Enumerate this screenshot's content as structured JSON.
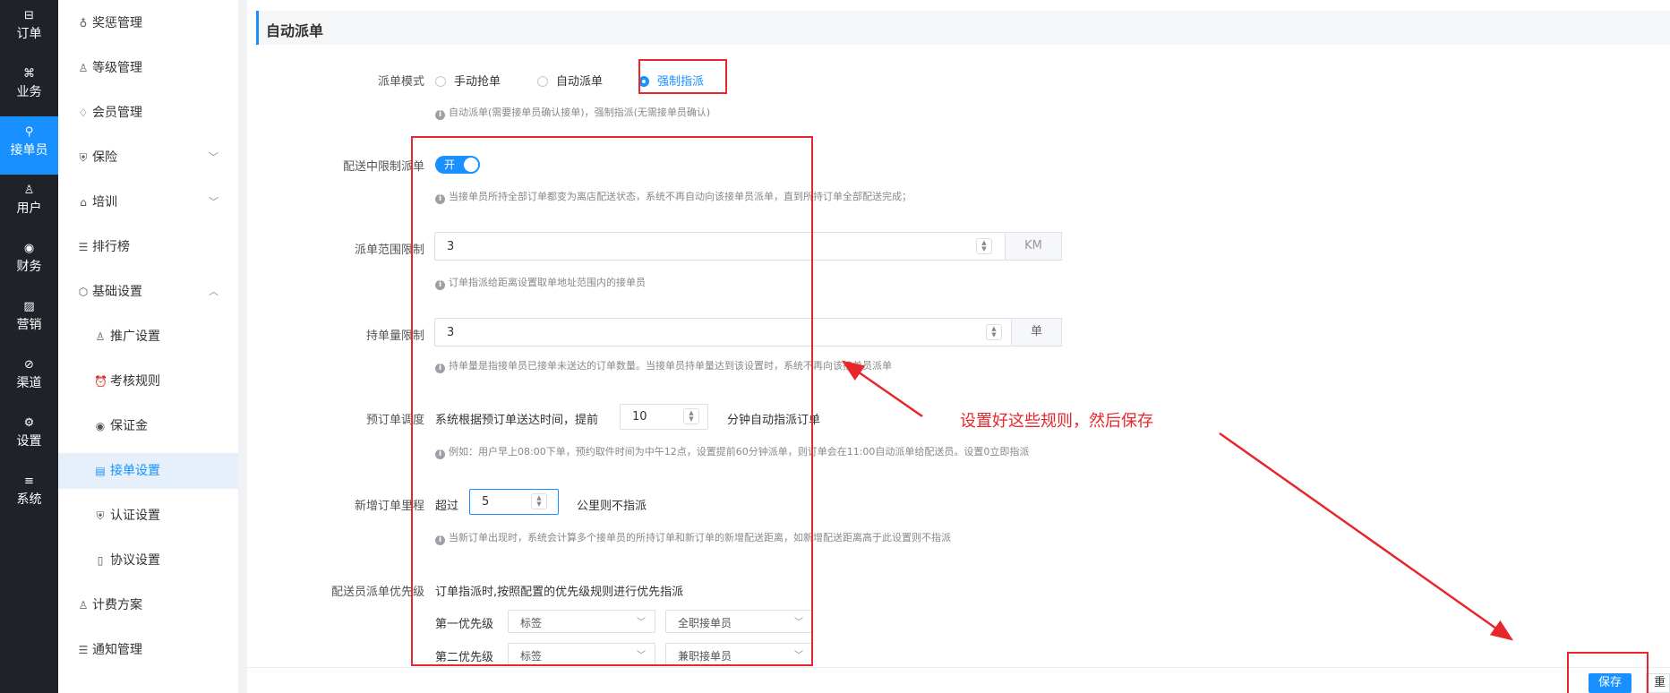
{
  "rail": [
    {
      "icon": "order-icon",
      "glyph": "⊟",
      "label": "订单"
    },
    {
      "icon": "business-icon",
      "glyph": "⌘",
      "label": "业务"
    },
    {
      "icon": "rider-icon",
      "glyph": "⚲",
      "label": "接单员",
      "active": true
    },
    {
      "icon": "user-icon",
      "glyph": "♙",
      "label": "用户"
    },
    {
      "icon": "finance-icon",
      "glyph": "◉",
      "label": "财务"
    },
    {
      "icon": "marketing-icon",
      "glyph": "▨",
      "label": "营销"
    },
    {
      "icon": "channel-icon",
      "glyph": "⊘",
      "label": "渠道"
    },
    {
      "icon": "settings-icon",
      "glyph": "⚙",
      "label": "设置"
    },
    {
      "icon": "system-icon",
      "glyph": "≡",
      "label": "系统"
    }
  ],
  "sidebar": {
    "items": [
      {
        "label": "奖惩管理",
        "icon": "medal-icon",
        "glyph": "♁"
      },
      {
        "label": "等级管理",
        "icon": "user-level-icon",
        "glyph": "♙"
      },
      {
        "label": "会员管理",
        "icon": "diamond-icon",
        "glyph": "♢"
      },
      {
        "label": "保险",
        "icon": "shield-icon",
        "glyph": "⛨",
        "chevron": "﹀"
      },
      {
        "label": "培训",
        "icon": "training-icon",
        "glyph": "⌂",
        "chevron": "﹀"
      },
      {
        "label": "排行榜",
        "icon": "list-icon",
        "glyph": "☰"
      },
      {
        "label": "基础设置",
        "icon": "hexagon-icon",
        "glyph": "⬡",
        "chevron": "︿"
      },
      {
        "label": "推广设置",
        "icon": "promote-icon",
        "glyph": "♙",
        "sub": true
      },
      {
        "label": "考核规则",
        "icon": "alarm-icon",
        "glyph": "⏰",
        "sub": true
      },
      {
        "label": "保证金",
        "icon": "deposit-icon",
        "glyph": "◉",
        "sub": true
      },
      {
        "label": "接单设置",
        "icon": "doc-settings-icon",
        "glyph": "▤",
        "sub": true,
        "active": true
      },
      {
        "label": "认证设置",
        "icon": "verify-icon",
        "glyph": "⛨",
        "sub": true
      },
      {
        "label": "协议设置",
        "icon": "book-icon",
        "glyph": "▯",
        "sub": true
      },
      {
        "label": "计费方案",
        "icon": "billing-icon",
        "glyph": "♙"
      },
      {
        "label": "通知管理",
        "icon": "notice-icon",
        "glyph": "☰"
      }
    ]
  },
  "section_title": "自动派单",
  "dispatch_mode": {
    "label": "派单模式",
    "options": [
      "手动抢单",
      "自动派单",
      "强制指派"
    ],
    "selected": "强制指派",
    "hint": "自动派单(需要接单员确认接单)，强制指派(无需接单员确认)"
  },
  "limit_in_delivery": {
    "label": "配送中限制派单",
    "switch_text": "开",
    "hint": "当接单员所持全部订单都变为离店配送状态，系统不再自动向该接单员派单，直到所持订单全部配送完成；"
  },
  "range_limit": {
    "label": "派单范围限制",
    "value": "3",
    "unit": "KM",
    "hint": "订单指派给距离设置取单地址范围内的接单员"
  },
  "hold_limit": {
    "label": "持单量限制",
    "value": "3",
    "unit": "单",
    "hint": "持单量是指接单员已接单未送达的订单数量。当接单员持单量达到该设置时，系统不再向该接单员派单"
  },
  "preorder": {
    "label": "预订单调度",
    "prefix": "系统根据预订单送达时间，提前",
    "value": "10",
    "suffix": "分钟自动指派订单",
    "hint": "例如：用户早上08:00下单，预约取件时间为中午12点，设置提前60分钟派单，则订单会在11:00自动派单给配送员。设置0立即指派"
  },
  "new_order_distance": {
    "label": "新增订单里程",
    "prefix": "超过",
    "value": "5",
    "suffix": "公里则不指派",
    "hint": "当新订单出现时，系统会计算多个接单员的所持订单和新订单的新增配送距离，如新增配送距离高于此设置则不指派"
  },
  "priority": {
    "label": "配送员派单优先级",
    "description": "订单指派时,按照配置的优先级规则进行优先指派",
    "rows": [
      {
        "label": "第一优先级",
        "type": "标签",
        "value": "全职接单员"
      },
      {
        "label": "第二优先级",
        "type": "标签",
        "value": "兼职接单员"
      }
    ]
  },
  "footer": {
    "save_label": "保存",
    "other_label": "重置"
  },
  "annotation": {
    "text": "设置好这些规则，然后保存",
    "color": "#e8262b"
  },
  "colors": {
    "accent": "#1890ff",
    "rail_bg": "#1f2329",
    "annotation_red": "#e8262b"
  }
}
